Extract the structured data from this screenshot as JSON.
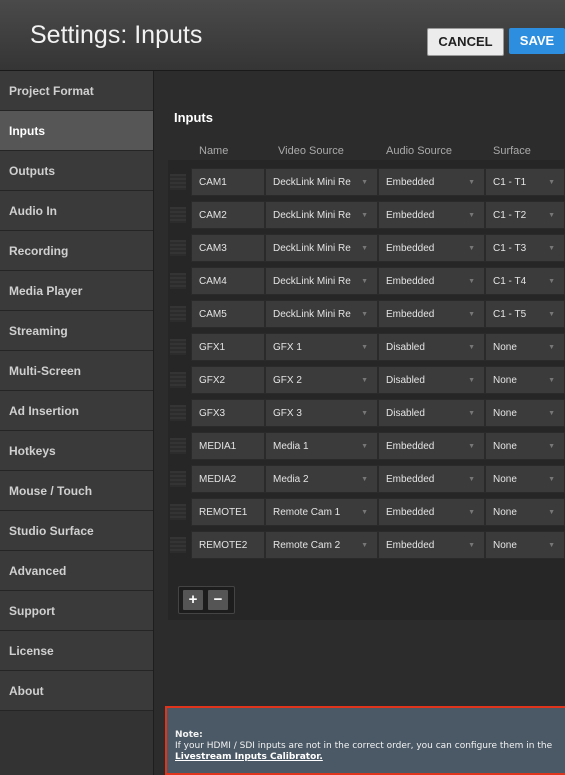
{
  "header": {
    "title": "Settings: Inputs",
    "cancel_label": "CANCEL",
    "save_label": "SAVE"
  },
  "sidebar": {
    "items": [
      "Project Format",
      "Inputs",
      "Outputs",
      "Audio In",
      "Recording",
      "Media Player",
      "Streaming",
      "Multi-Screen",
      "Ad Insertion",
      "Hotkeys",
      "Mouse / Touch",
      "Studio Surface",
      "Advanced",
      "Support",
      "License",
      "About"
    ],
    "active": "Inputs"
  },
  "inputs": {
    "heading": "Inputs",
    "columns": [
      "Name",
      "Video Source",
      "Audio Source",
      "Surface"
    ],
    "rows": [
      {
        "name": "CAM1",
        "video": "DeckLink Mini Re",
        "audio": "Embedded",
        "surface": "C1 - T1"
      },
      {
        "name": "CAM2",
        "video": "DeckLink Mini Re",
        "audio": "Embedded",
        "surface": "C1 - T2"
      },
      {
        "name": "CAM3",
        "video": "DeckLink Mini Re",
        "audio": "Embedded",
        "surface": "C1 - T3"
      },
      {
        "name": "CAM4",
        "video": "DeckLink Mini Re",
        "audio": "Embedded",
        "surface": "C1 - T4"
      },
      {
        "name": "CAM5",
        "video": "DeckLink Mini Re",
        "audio": "Embedded",
        "surface": "C1 - T5"
      },
      {
        "name": "GFX1",
        "video": "GFX 1",
        "audio": "Disabled",
        "surface": "None"
      },
      {
        "name": "GFX2",
        "video": "GFX 2",
        "audio": "Disabled",
        "surface": "None"
      },
      {
        "name": "GFX3",
        "video": "GFX 3",
        "audio": "Disabled",
        "surface": "None"
      },
      {
        "name": "MEDIA1",
        "video": "Media 1",
        "audio": "Embedded",
        "surface": "None"
      },
      {
        "name": "MEDIA2",
        "video": "Media 2",
        "audio": "Embedded",
        "surface": "None"
      },
      {
        "name": "REMOTE1",
        "video": "Remote Cam 1",
        "audio": "Embedded",
        "surface": "None"
      },
      {
        "name": "REMOTE2",
        "video": "Remote Cam 2",
        "audio": "Embedded",
        "surface": "None"
      }
    ],
    "add_label": "+",
    "remove_label": "−"
  },
  "note": {
    "heading": "Note:",
    "text": "If your HDMI / SDI inputs are not in the correct order, you can configure them in the ",
    "link": "Livestream Inputs Calibrator."
  }
}
